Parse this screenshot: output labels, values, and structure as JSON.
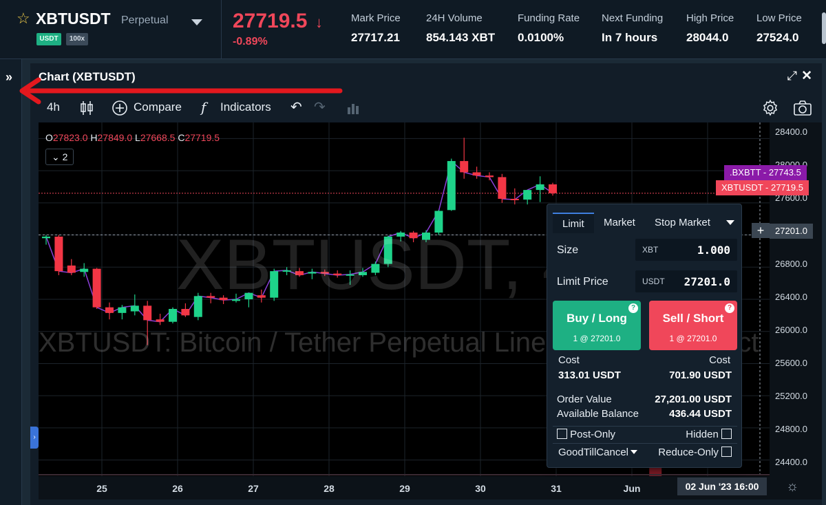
{
  "header": {
    "symbol": "XBTUSDT",
    "contract_type": "Perpetual",
    "badges": [
      "USDT",
      "100x"
    ],
    "last_price": "27719.5",
    "direction_arrow": "↓",
    "change_pct": "-0.89%",
    "stats": [
      {
        "label": "Mark Price",
        "value": "27717.21"
      },
      {
        "label": "24H Volume",
        "value": "854.143 XBT"
      },
      {
        "label": "Funding Rate",
        "value": "0.0100%"
      },
      {
        "label": "Next Funding",
        "value": "In 7 hours"
      },
      {
        "label": "High Price",
        "value": "28044.0"
      },
      {
        "label": "Low Price",
        "value": "27524.0"
      }
    ]
  },
  "panel": {
    "title": "Chart (XBTUSDT)"
  },
  "toolbar": {
    "interval": "4h",
    "compare": "Compare",
    "indicators": "Indicators",
    "fx": "f",
    "candle_icon": "candlestick-icon",
    "undo_icon": "undo-icon",
    "redo_icon": "redo-icon",
    "settings_icon": "gear-icon",
    "snapshot_icon": "camera-icon"
  },
  "chart": {
    "ohlc": {
      "o": "27823.0",
      "h": "27849.0",
      "l": "27668.5",
      "c": "27719.5"
    },
    "collapse_count": "2",
    "watermark_symbol": "XBTUSDT, 4h",
    "watermark_desc": "XBTUSDT: Bitcoin / Tether Perpetual Linear Swap Contract",
    "price_ticks": [
      "28400.0",
      "28000.0",
      "27600.0",
      "26800.0",
      "26400.0",
      "26000.0",
      "25600.0",
      "25200.0",
      "24800.0",
      "24400.0"
    ],
    "crosshair_price": "27201.0",
    "tags": [
      {
        "label": ".BXBTT - 27743.5",
        "color": "#8b1aa8"
      },
      {
        "label": "XBTUSDT - 27719.5",
        "color": "#f0475a"
      }
    ],
    "date_ticks": [
      "25",
      "26",
      "27",
      "28",
      "29",
      "30",
      "31",
      "Jun"
    ],
    "crosshair_date": "02 Jun '23   16:00"
  },
  "chart_data": {
    "type": "candlestick",
    "ylim": [
      24200,
      28600
    ],
    "candles": [
      [
        27160,
        27200,
        27080,
        27180
      ],
      [
        27180,
        27200,
        26700,
        26750
      ],
      [
        26820,
        26900,
        26700,
        26730
      ],
      [
        26740,
        26850,
        26680,
        26780
      ],
      [
        26780,
        26790,
        26280,
        26300
      ],
      [
        26300,
        26360,
        26150,
        26230
      ],
      [
        26230,
        26330,
        26150,
        26300
      ],
      [
        26250,
        26460,
        26200,
        26320
      ],
      [
        26320,
        26380,
        25830,
        26140
      ],
      [
        26150,
        26220,
        26080,
        26120
      ],
      [
        26120,
        26300,
        26100,
        26280
      ],
      [
        26280,
        26350,
        26180,
        26200
      ],
      [
        26180,
        26480,
        26140,
        26440
      ],
      [
        26440,
        26480,
        26350,
        26420
      ],
      [
        26420,
        26450,
        26340,
        26390
      ],
      [
        26380,
        26470,
        26360,
        26400
      ],
      [
        26400,
        26480,
        26300,
        26480
      ],
      [
        26450,
        26520,
        26360,
        26420
      ],
      [
        26420,
        26780,
        26380,
        26750
      ],
      [
        26760,
        26800,
        26700,
        26760
      ],
      [
        26750,
        26790,
        26680,
        26700
      ],
      [
        26720,
        26780,
        26650,
        26740
      ],
      [
        26740,
        26770,
        26690,
        26720
      ],
      [
        26720,
        26760,
        26670,
        26700
      ],
      [
        26700,
        26760,
        26580,
        26710
      ],
      [
        26700,
        26790,
        26680,
        26740
      ],
      [
        26730,
        26870,
        26700,
        26840
      ],
      [
        26840,
        27190,
        26800,
        27180
      ],
      [
        27180,
        27250,
        27120,
        27230
      ],
      [
        27230,
        27250,
        27110,
        27160
      ],
      [
        27140,
        27260,
        27110,
        27230
      ],
      [
        27230,
        27510,
        27200,
        27500
      ],
      [
        27510,
        28150,
        27500,
        28120
      ],
      [
        28120,
        28410,
        27900,
        27980
      ],
      [
        27980,
        28050,
        27900,
        27940
      ],
      [
        27940,
        27980,
        27880,
        27920
      ],
      [
        27920,
        27960,
        27600,
        27650
      ],
      [
        27650,
        27780,
        27580,
        27640
      ],
      [
        27640,
        27760,
        27580,
        27760
      ],
      [
        27760,
        27930,
        27610,
        27830
      ],
      [
        27830,
        27850,
        27690,
        27720
      ]
    ],
    "volume_spike": {
      "candle_index": 48,
      "value_rel": 0.83
    }
  },
  "order": {
    "tabs": [
      "Limit",
      "Market",
      "Stop Market"
    ],
    "size_label": "Size",
    "size_unit": "XBT",
    "size_value": "1.000",
    "price_label": "Limit Price",
    "price_unit": "USDT",
    "price_value": "27201.0",
    "buy_label": "Buy / Long",
    "buy_sub": "1 @ 27201.0",
    "sell_label": "Sell / Short",
    "sell_sub": "1 @ 27201.0",
    "help": "?",
    "cost_label": "Cost",
    "buy_cost": "313.01 USDT",
    "sell_cost": "701.90 USDT",
    "order_value_label": "Order Value",
    "order_value": "27,201.00 USDT",
    "balance_label": "Available Balance",
    "balance": "436.44 USDT",
    "post_only": "Post-Only",
    "hidden": "Hidden",
    "tif": "GoodTillCancel",
    "reduce_only": "Reduce-Only"
  }
}
